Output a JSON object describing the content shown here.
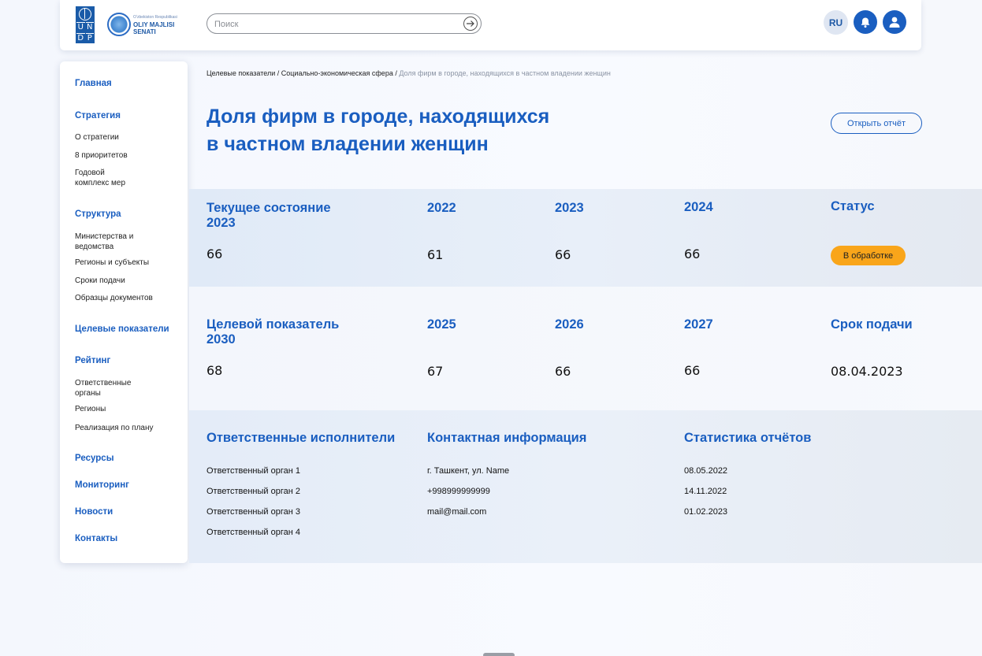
{
  "header": {
    "undp_letters": [
      "U",
      "N",
      "D",
      "P"
    ],
    "senat_small": "Oʻzbekiston Respublikasi",
    "senat_big_1": "OLIY MAJLISI",
    "senat_big_2": "SENATI",
    "search_placeholder": "Поиск",
    "lang": "RU"
  },
  "sidebar": {
    "home": "Главная",
    "strategy": "Стратегия",
    "strategy_items": [
      "О стратегии",
      "8 приоритетов",
      "Годовой комплекс мер"
    ],
    "structure": "Структура",
    "structure_items": [
      "Министерства и ведомства",
      "Регионы и субъекты",
      "Сроки подачи",
      "Образцы документов"
    ],
    "targets": "Целевые показатели",
    "rating": "Рейтинг",
    "rating_items": [
      "Ответственные органы",
      "Регионы",
      "Реализация по плану"
    ],
    "resources": "Ресурсы",
    "monitoring": "Мониторинг",
    "news": "Новости",
    "contacts": "Контакты"
  },
  "breadcrumb": {
    "part1": "Целевые показатели",
    "sep": " / ",
    "part2": "Социально-экономическая сфера",
    "current": "Доля фирм в городе, находящихся в частном владении женщин"
  },
  "page": {
    "title_line1": "Доля фирм в городе, находящихся",
    "title_line2": "в частном владении женщин",
    "open_report": "Открыть отчёт"
  },
  "current_state": {
    "label_line1": "Текущее состояние",
    "label_line2": "2023",
    "value": "66",
    "years": [
      {
        "year": "2022",
        "value": "61"
      },
      {
        "year": "2023",
        "value": "66"
      },
      {
        "year": "2024",
        "value": "66"
      }
    ],
    "status_label": "Статус",
    "status_value": "В обработке"
  },
  "target": {
    "label_line1": "Целевой показатель",
    "label_line2": "2030",
    "value": "68",
    "years": [
      {
        "year": "2025",
        "value": "67"
      },
      {
        "year": "2026",
        "value": "66"
      },
      {
        "year": "2027",
        "value": "66"
      }
    ],
    "deadline_label": "Срок подачи",
    "deadline_value": "08.04.2023"
  },
  "details": {
    "executors_title": "Ответственные исполнители",
    "executors": [
      "Ответственный орган 1",
      "Ответственный орган 2",
      "Ответственный орган 3",
      "Ответственный орган 4"
    ],
    "contacts_title": "Контактная информация",
    "contacts": [
      "г. Ташкент, ул. Name",
      "+998999999999",
      "mail@mail.com"
    ],
    "stats_title": "Статистика отчётов",
    "stats": [
      "08.05.2022",
      "14.11.2022",
      "01.02.2023"
    ]
  },
  "colors": {
    "accent": "#1a5ec0",
    "status_badge": "#f9a51a"
  }
}
